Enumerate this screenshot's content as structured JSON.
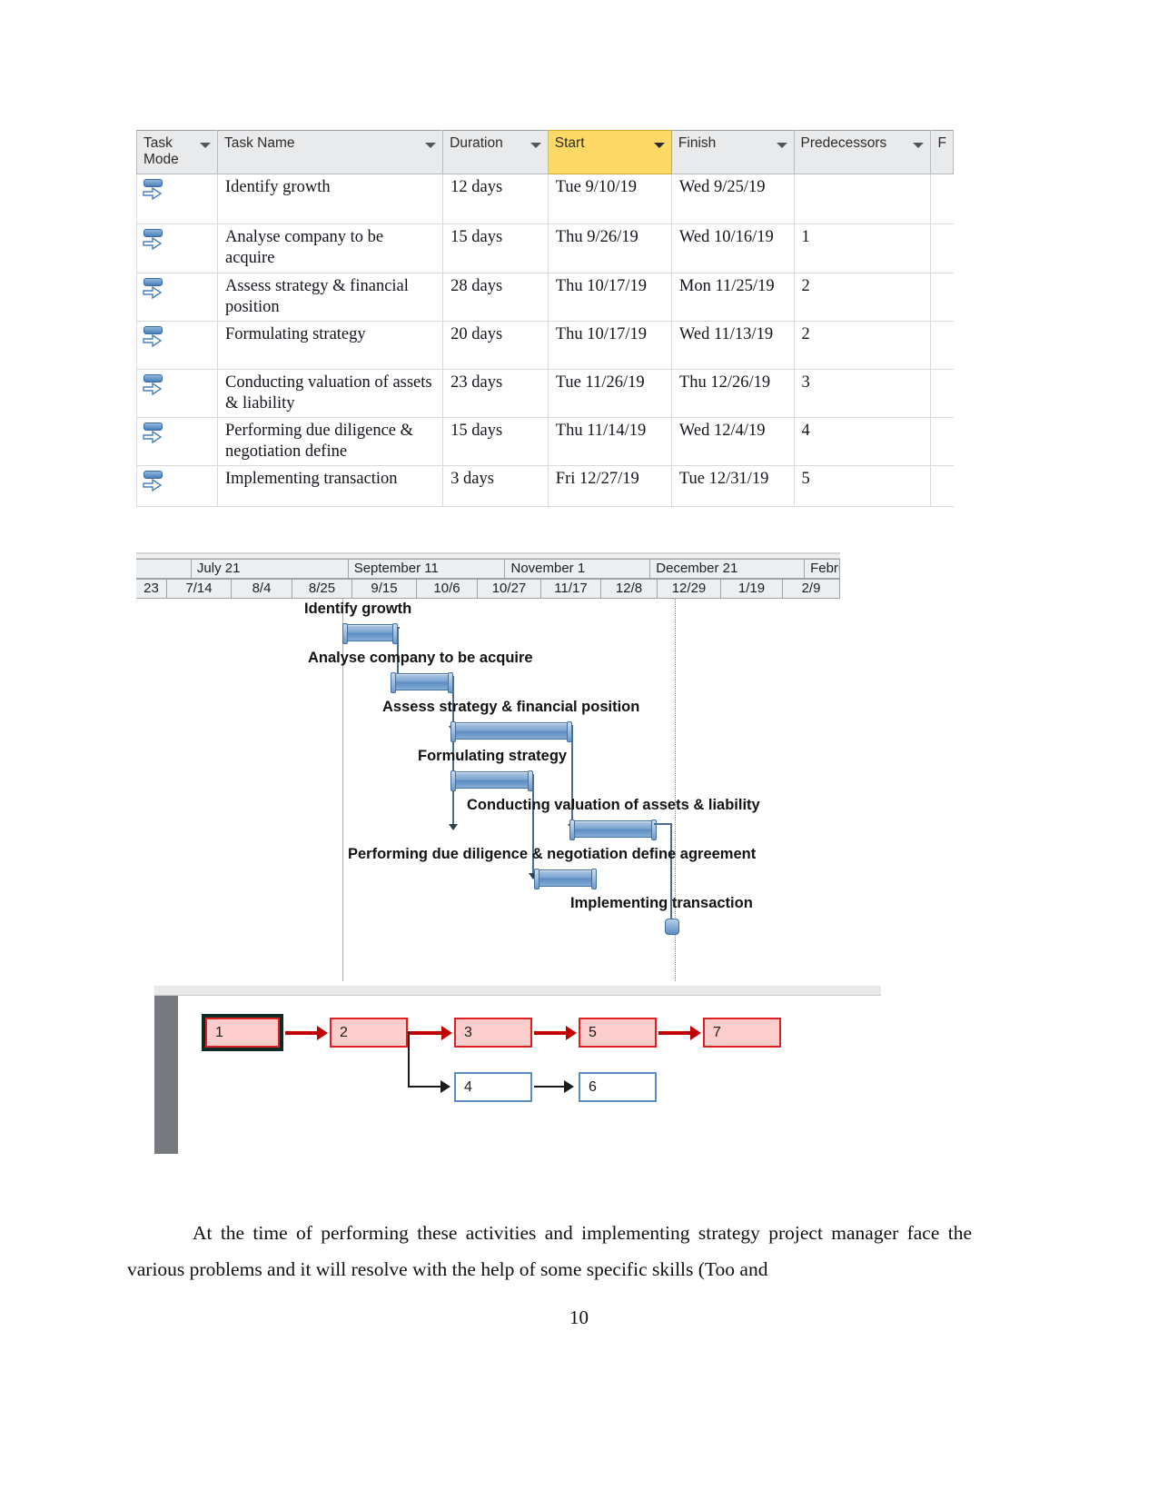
{
  "project_table": {
    "columns": [
      {
        "label": "Task Mode",
        "has_filter": true,
        "highlighted": false
      },
      {
        "label": "Task Name",
        "has_filter": true,
        "highlighted": false
      },
      {
        "label": "Duration",
        "has_filter": true,
        "highlighted": false
      },
      {
        "label": "Start",
        "has_filter": true,
        "highlighted": true
      },
      {
        "label": "Finish",
        "has_filter": true,
        "highlighted": false
      },
      {
        "label": "Predecessors",
        "has_filter": true,
        "highlighted": false
      },
      {
        "label": "F",
        "has_filter": false,
        "highlighted": false
      }
    ],
    "rows": [
      {
        "id": 1,
        "mode_icon": "manually-scheduled-icon",
        "name": "Identify growth",
        "duration": "12 days",
        "start": "Tue 9/10/19",
        "finish": "Wed 9/25/19",
        "predecessors": ""
      },
      {
        "id": 2,
        "mode_icon": "manually-scheduled-icon",
        "name": "Analyse company to be acquire",
        "duration": "15 days",
        "start": "Thu 9/26/19",
        "finish": "Wed 10/16/19",
        "predecessors": "1"
      },
      {
        "id": 3,
        "mode_icon": "manually-scheduled-icon",
        "name": "Assess strategy & financial position",
        "duration": "28 days",
        "start": "Thu 10/17/19",
        "finish": "Mon 11/25/19",
        "predecessors": "2"
      },
      {
        "id": 4,
        "mode_icon": "manually-scheduled-icon",
        "name": "Formulating strategy",
        "duration": "20 days",
        "start": "Thu 10/17/19",
        "finish": "Wed 11/13/19",
        "predecessors": "2"
      },
      {
        "id": 5,
        "mode_icon": "manually-scheduled-icon",
        "name": "Conducting valuation of assets & liability",
        "duration": "23 days",
        "start": "Tue 11/26/19",
        "finish": "Thu 12/26/19",
        "predecessors": "3"
      },
      {
        "id": 6,
        "mode_icon": "manually-scheduled-icon",
        "name": "Performing due diligence & negotiation define",
        "duration": "15 days",
        "start": "Thu 11/14/19",
        "finish": "Wed 12/4/19",
        "predecessors": "4"
      },
      {
        "id": 7,
        "mode_icon": "manually-scheduled-icon",
        "name": "Implementing transaction",
        "duration": "3 days",
        "start": "Fri 12/27/19",
        "finish": "Tue 12/31/19",
        "predecessors": "5"
      }
    ]
  },
  "gantt": {
    "timeline_major": [
      "July 21",
      "September 11",
      "November 1",
      "December 21",
      "Febru"
    ],
    "timeline_minor": [
      "23",
      "7/14",
      "8/4",
      "8/25",
      "9/15",
      "10/6",
      "10/27",
      "11/17",
      "12/8",
      "12/29",
      "1/19",
      "2/9"
    ],
    "bars": [
      {
        "label": "Identify growth",
        "duration": "12 days"
      },
      {
        "label": "Analyse company to be acquire",
        "duration": "15 days"
      },
      {
        "label": "Assess strategy & financial position",
        "duration": "28 days"
      },
      {
        "label": "Formulating strategy",
        "duration": "20 days"
      },
      {
        "label": "Conducting valuation of assets & liability",
        "duration": "23 days"
      },
      {
        "label": "Performing due diligence & negotiation define agreement",
        "duration": "15 days"
      },
      {
        "label": "Implementing transaction",
        "duration": "3 days"
      }
    ],
    "colors": {
      "bar_fill": "#5b8cc2",
      "bar_border": "#43709f",
      "today_line": "#e8a33d",
      "status_line": "#8a8a8a"
    }
  },
  "network_diagram": {
    "critical_nodes": [
      "1",
      "2",
      "3",
      "5",
      "7"
    ],
    "noncritical_nodes": [
      "4",
      "6"
    ],
    "colors": {
      "critical_fill": "#fbcdcd",
      "critical_border": "#e02020",
      "arrow": "#c00000",
      "noncritical_border": "#5b8cc2"
    }
  },
  "body": {
    "paragraph": "At the time of performing these activities and implementing strategy project manager face the various problems and it will resolve with the help of some specific skills (Too and",
    "page_number": "10"
  }
}
